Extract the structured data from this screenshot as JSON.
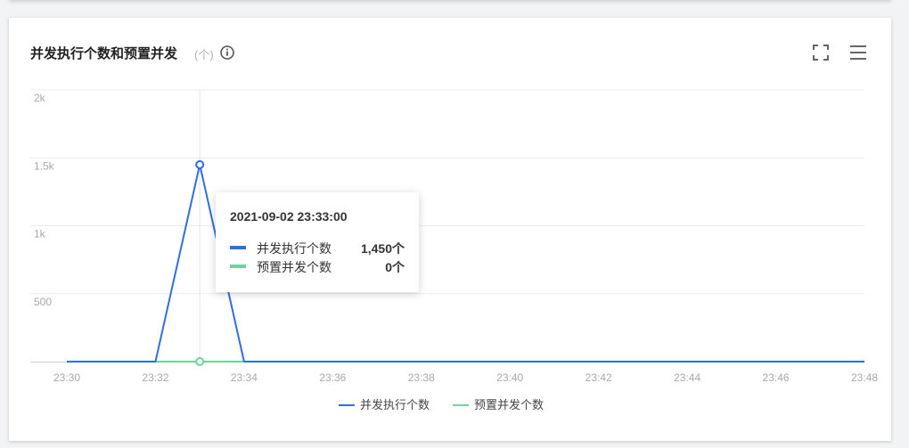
{
  "card": {
    "title": "并发执行个数和预置并发",
    "unit": "(个)"
  },
  "icons": {
    "info": "info-circle-icon",
    "fullscreen": "fullscreen-icon",
    "menu": "hamburger-menu-icon"
  },
  "colors": {
    "series1": "#2f6fe0",
    "series2": "#6fd39a",
    "grid": "#ececec",
    "axis_text": "#a8a8a8"
  },
  "tooltip": {
    "title": "2021-09-02 23:33:00",
    "rows": [
      {
        "name": "并发执行个数",
        "value": "1,450个"
      },
      {
        "name": "预置并发个数",
        "value": "0个"
      }
    ]
  },
  "chart_data": {
    "type": "line",
    "x": [
      "23:30",
      "23:31",
      "23:32",
      "23:33",
      "23:34",
      "23:35",
      "23:36",
      "23:37",
      "23:38",
      "23:39",
      "23:40",
      "23:41",
      "23:42",
      "23:43",
      "23:44",
      "23:45",
      "23:46",
      "23:47",
      "23:48"
    ],
    "x_tick_labels": [
      "23:30",
      "23:32",
      "23:34",
      "23:36",
      "23:38",
      "23:40",
      "23:42",
      "23:44",
      "23:46",
      "23:48"
    ],
    "y_tick_labels": [
      "500",
      "1k",
      "1.5k",
      "2k"
    ],
    "y_ticks": [
      500,
      1000,
      1500,
      2000
    ],
    "ylim": [
      0,
      2000
    ],
    "grid": true,
    "legend_position": "bottom",
    "highlight_index": 3,
    "series": [
      {
        "name": "并发执行个数",
        "values": [
          0,
          0,
          0,
          1450,
          0,
          0,
          0,
          0,
          0,
          0,
          0,
          0,
          0,
          0,
          0,
          0,
          0,
          0,
          0
        ]
      },
      {
        "name": "预置并发个数",
        "values": [
          0,
          0,
          0,
          0,
          0,
          0,
          0,
          0,
          0,
          0,
          0,
          0,
          0,
          0,
          0,
          0,
          0,
          0,
          0
        ]
      }
    ]
  }
}
